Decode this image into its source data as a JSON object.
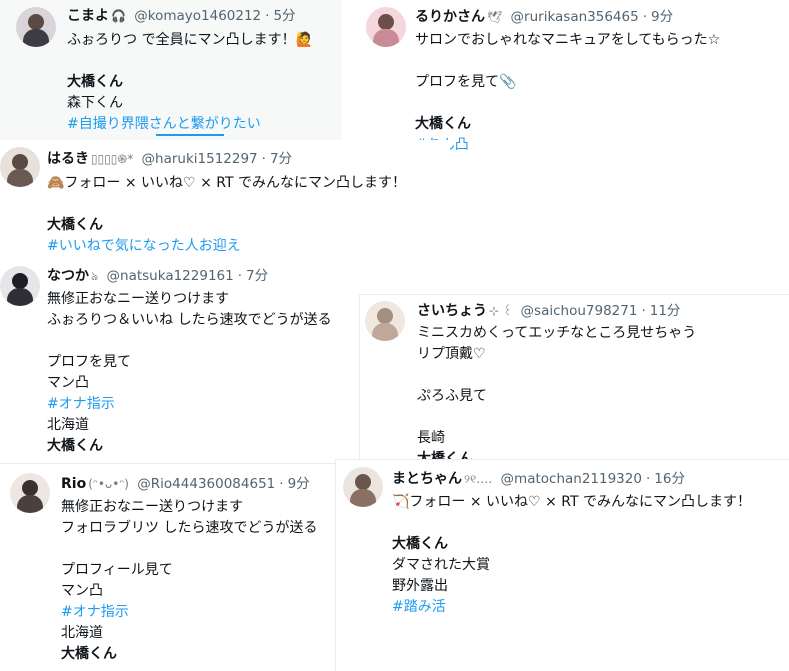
{
  "tweets": [
    {
      "name": "こまよ",
      "emoji": "🎧",
      "handle": "@komayo1460212",
      "time": "5分",
      "lines": [
        {
          "text": "ふぉろりつ で全員にマン凸します！🙋",
          "style": "normal"
        },
        {
          "text": "",
          "style": "blank"
        },
        {
          "text": "大橋くん",
          "style": "bold"
        },
        {
          "text": "森下くん",
          "style": "normal"
        },
        {
          "text": "#自撮り界隈さんと繋がりたい",
          "style": "tag"
        }
      ],
      "avatar_colors": [
        "#d9d4d9",
        "#3d3b44"
      ]
    },
    {
      "name": "るりかさん",
      "emoji": "🕊",
      "handle": "@rurikasan356465",
      "time": "9分",
      "lines": [
        {
          "text": "サロンでおしゃれなマニキュアをしてもらった☆",
          "style": "normal"
        },
        {
          "text": "",
          "style": "blank"
        },
        {
          "text": "プロフを見て📎",
          "style": "normal"
        },
        {
          "text": "",
          "style": "blank"
        },
        {
          "text": "大橋くん",
          "style": "bold"
        },
        {
          "text": "#ちん凸",
          "style": "tag"
        }
      ],
      "avatar_colors": [
        "#f3d7dc",
        "#c98c96"
      ]
    },
    {
      "name": "はるき",
      "emoji": "▯▯▯▯֍*",
      "handle": "@haruki1512297",
      "time": "7分",
      "lines": [
        {
          "text": "🙈フォロー × いいね♡ × RT でみんなにマン凸します！",
          "style": "normal"
        },
        {
          "text": "",
          "style": "blank"
        },
        {
          "text": "大橋くん",
          "style": "bold"
        },
        {
          "text": "#いいねで気になった人お迎え",
          "style": "tag"
        }
      ],
      "avatar_colors": [
        "#e8e0da",
        "#6b5a52"
      ]
    },
    {
      "name": "なつか",
      "emoji": "ঌ",
      "handle": "@natsuka1229161",
      "time": "7分",
      "lines": [
        {
          "text": "無修正おなニー送りつけます",
          "style": "normal"
        },
        {
          "text": "ふぉろりつ＆いいね したら速攻でどうが送る",
          "style": "normal"
        },
        {
          "text": "",
          "style": "blank"
        },
        {
          "text": "プロフを見て",
          "style": "normal"
        },
        {
          "text": "マン凸",
          "style": "normal"
        },
        {
          "text": "#オナ指示",
          "style": "tag"
        },
        {
          "text": "北海道",
          "style": "normal"
        },
        {
          "text": "大橋くん",
          "style": "bold"
        }
      ],
      "avatar_colors": [
        "#e6e6ea",
        "#2f2d35"
      ]
    },
    {
      "name": "さいちょう",
      "emoji": "⊹ ꒰",
      "handle": "@saichou798271",
      "time": "11分",
      "lines": [
        {
          "text": "ミニスカめくってエッチなところ見せちゃう",
          "style": "normal"
        },
        {
          "text": "リプ頂戴♡",
          "style": "normal"
        },
        {
          "text": "",
          "style": "blank"
        },
        {
          "text": "ぷろふ見て",
          "style": "normal"
        },
        {
          "text": "",
          "style": "blank"
        },
        {
          "text": "長崎",
          "style": "normal"
        },
        {
          "text": "大橋くん",
          "style": "bold"
        }
      ],
      "avatar_colors": [
        "#f1e7e1",
        "#bfa89a"
      ]
    },
    {
      "name": "Rio",
      "emoji": "(ᵔ•ᴗ•ᵔ)",
      "handle": "@Rio444360084651",
      "time": "9分",
      "lines": [
        {
          "text": "無修正おなニー送りつけます",
          "style": "normal"
        },
        {
          "text": "フォロラブリツ したら速攻でどうが送る",
          "style": "normal"
        },
        {
          "text": "",
          "style": "blank"
        },
        {
          "text": "プロフィール見て",
          "style": "normal"
        },
        {
          "text": "マン凸",
          "style": "normal"
        },
        {
          "text": "#オナ指示",
          "style": "tag"
        },
        {
          "text": "北海道",
          "style": "normal"
        },
        {
          "text": "大橋くん",
          "style": "bold"
        }
      ],
      "avatar_colors": [
        "#ede6e2",
        "#4a403c"
      ]
    },
    {
      "name": "まとちゃん",
      "emoji": "୨୧‥‥",
      "handle": "@matochan2119320",
      "time": "16分",
      "lines": [
        {
          "text": "🏹フォロー × いいね♡ × RT でみんなにマン凸します！",
          "style": "normal"
        },
        {
          "text": "",
          "style": "blank"
        },
        {
          "text": "大橋くん",
          "style": "bold"
        },
        {
          "text": "ダマされた大賞",
          "style": "normal"
        },
        {
          "text": "野外露出",
          "style": "normal"
        },
        {
          "text": "#踏み活",
          "style": "tag"
        }
      ],
      "avatar_colors": [
        "#ebe5e0",
        "#8a6f62"
      ]
    }
  ]
}
